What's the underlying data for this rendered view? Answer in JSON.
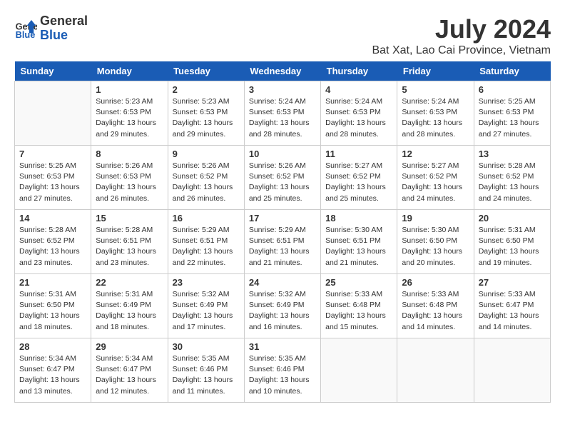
{
  "header": {
    "logo_line1": "General",
    "logo_line2": "Blue",
    "month": "July 2024",
    "location": "Bat Xat, Lao Cai Province, Vietnam"
  },
  "days_of_week": [
    "Sunday",
    "Monday",
    "Tuesday",
    "Wednesday",
    "Thursday",
    "Friday",
    "Saturday"
  ],
  "weeks": [
    [
      {
        "day": "",
        "info": ""
      },
      {
        "day": "1",
        "info": "Sunrise: 5:23 AM\nSunset: 6:53 PM\nDaylight: 13 hours\nand 29 minutes."
      },
      {
        "day": "2",
        "info": "Sunrise: 5:23 AM\nSunset: 6:53 PM\nDaylight: 13 hours\nand 29 minutes."
      },
      {
        "day": "3",
        "info": "Sunrise: 5:24 AM\nSunset: 6:53 PM\nDaylight: 13 hours\nand 28 minutes."
      },
      {
        "day": "4",
        "info": "Sunrise: 5:24 AM\nSunset: 6:53 PM\nDaylight: 13 hours\nand 28 minutes."
      },
      {
        "day": "5",
        "info": "Sunrise: 5:24 AM\nSunset: 6:53 PM\nDaylight: 13 hours\nand 28 minutes."
      },
      {
        "day": "6",
        "info": "Sunrise: 5:25 AM\nSunset: 6:53 PM\nDaylight: 13 hours\nand 27 minutes."
      }
    ],
    [
      {
        "day": "7",
        "info": "Sunrise: 5:25 AM\nSunset: 6:53 PM\nDaylight: 13 hours\nand 27 minutes."
      },
      {
        "day": "8",
        "info": "Sunrise: 5:26 AM\nSunset: 6:53 PM\nDaylight: 13 hours\nand 26 minutes."
      },
      {
        "day": "9",
        "info": "Sunrise: 5:26 AM\nSunset: 6:52 PM\nDaylight: 13 hours\nand 26 minutes."
      },
      {
        "day": "10",
        "info": "Sunrise: 5:26 AM\nSunset: 6:52 PM\nDaylight: 13 hours\nand 25 minutes."
      },
      {
        "day": "11",
        "info": "Sunrise: 5:27 AM\nSunset: 6:52 PM\nDaylight: 13 hours\nand 25 minutes."
      },
      {
        "day": "12",
        "info": "Sunrise: 5:27 AM\nSunset: 6:52 PM\nDaylight: 13 hours\nand 24 minutes."
      },
      {
        "day": "13",
        "info": "Sunrise: 5:28 AM\nSunset: 6:52 PM\nDaylight: 13 hours\nand 24 minutes."
      }
    ],
    [
      {
        "day": "14",
        "info": "Sunrise: 5:28 AM\nSunset: 6:52 PM\nDaylight: 13 hours\nand 23 minutes."
      },
      {
        "day": "15",
        "info": "Sunrise: 5:28 AM\nSunset: 6:51 PM\nDaylight: 13 hours\nand 23 minutes."
      },
      {
        "day": "16",
        "info": "Sunrise: 5:29 AM\nSunset: 6:51 PM\nDaylight: 13 hours\nand 22 minutes."
      },
      {
        "day": "17",
        "info": "Sunrise: 5:29 AM\nSunset: 6:51 PM\nDaylight: 13 hours\nand 21 minutes."
      },
      {
        "day": "18",
        "info": "Sunrise: 5:30 AM\nSunset: 6:51 PM\nDaylight: 13 hours\nand 21 minutes."
      },
      {
        "day": "19",
        "info": "Sunrise: 5:30 AM\nSunset: 6:50 PM\nDaylight: 13 hours\nand 20 minutes."
      },
      {
        "day": "20",
        "info": "Sunrise: 5:31 AM\nSunset: 6:50 PM\nDaylight: 13 hours\nand 19 minutes."
      }
    ],
    [
      {
        "day": "21",
        "info": "Sunrise: 5:31 AM\nSunset: 6:50 PM\nDaylight: 13 hours\nand 18 minutes."
      },
      {
        "day": "22",
        "info": "Sunrise: 5:31 AM\nSunset: 6:49 PM\nDaylight: 13 hours\nand 18 minutes."
      },
      {
        "day": "23",
        "info": "Sunrise: 5:32 AM\nSunset: 6:49 PM\nDaylight: 13 hours\nand 17 minutes."
      },
      {
        "day": "24",
        "info": "Sunrise: 5:32 AM\nSunset: 6:49 PM\nDaylight: 13 hours\nand 16 minutes."
      },
      {
        "day": "25",
        "info": "Sunrise: 5:33 AM\nSunset: 6:48 PM\nDaylight: 13 hours\nand 15 minutes."
      },
      {
        "day": "26",
        "info": "Sunrise: 5:33 AM\nSunset: 6:48 PM\nDaylight: 13 hours\nand 14 minutes."
      },
      {
        "day": "27",
        "info": "Sunrise: 5:33 AM\nSunset: 6:47 PM\nDaylight: 13 hours\nand 14 minutes."
      }
    ],
    [
      {
        "day": "28",
        "info": "Sunrise: 5:34 AM\nSunset: 6:47 PM\nDaylight: 13 hours\nand 13 minutes."
      },
      {
        "day": "29",
        "info": "Sunrise: 5:34 AM\nSunset: 6:47 PM\nDaylight: 13 hours\nand 12 minutes."
      },
      {
        "day": "30",
        "info": "Sunrise: 5:35 AM\nSunset: 6:46 PM\nDaylight: 13 hours\nand 11 minutes."
      },
      {
        "day": "31",
        "info": "Sunrise: 5:35 AM\nSunset: 6:46 PM\nDaylight: 13 hours\nand 10 minutes."
      },
      {
        "day": "",
        "info": ""
      },
      {
        "day": "",
        "info": ""
      },
      {
        "day": "",
        "info": ""
      }
    ]
  ]
}
